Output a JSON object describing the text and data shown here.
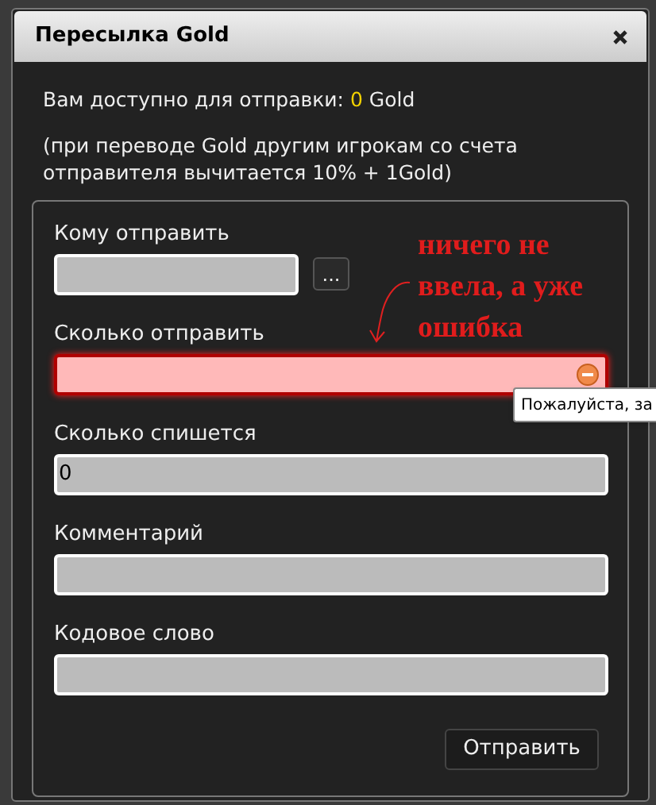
{
  "window": {
    "title": "Пересылка Gold"
  },
  "balance": {
    "prefix": "Вам доступно для отправки:",
    "amount": "0",
    "suffix": "Gold"
  },
  "note": "(при переводе Gold другим игрокам со счета отправителя вычитается 10% + 1Gold)",
  "fields": [
    {
      "label": "Кому отправить",
      "kind": "picker",
      "picker_button": "...",
      "invalid": false
    },
    {
      "label": "Сколько отправить",
      "kind": "text",
      "invalid": true
    },
    {
      "label": "Сколько спишется",
      "kind": "text",
      "value": "0",
      "invalid": false
    },
    {
      "label": "Комментарий",
      "kind": "text",
      "invalid": false
    },
    {
      "label": "Кодовое слово",
      "kind": "text",
      "invalid": false
    }
  ],
  "tooltip": "Пожалуйста, за",
  "annotation": "ничего не\nввела, а уже\nошибка",
  "submit_button": "Отправить"
}
